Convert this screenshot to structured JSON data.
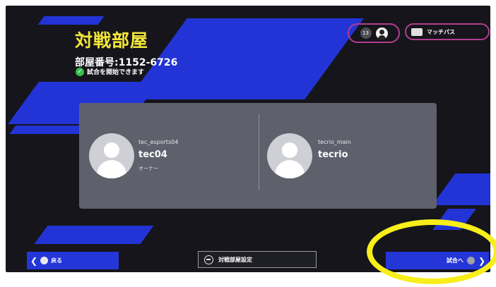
{
  "header": {
    "title": "対戦部屋",
    "room_number": "部屋番号:1152-6726",
    "status": "試合を開始できます"
  },
  "top_right": {
    "count_badge": "13",
    "match_pass_label": "マッチパス"
  },
  "players": [
    {
      "id": "tec_esports04",
      "name": "tec04",
      "role": "オーナー"
    },
    {
      "id": "tecrio_main",
      "name": "tecrio",
      "role": ""
    }
  ],
  "footer": {
    "back_label": "戻る",
    "settings_label": "対戦部屋設定",
    "next_label": "試合へ"
  },
  "colors": {
    "accent_blue": "#2436d8",
    "title_yellow": "#f4e73b",
    "highlight_yellow": "#f7ee1a",
    "pill_border": "#b23d8f",
    "panel_gray": "#5e606c",
    "ok_green": "#34c04c"
  },
  "icons": [
    "check-icon",
    "user-icon",
    "match-pass-icon",
    "avatar-icon",
    "chevron-left-icon",
    "chevron-right-icon",
    "globe-icon",
    "button-circle-icon"
  ]
}
